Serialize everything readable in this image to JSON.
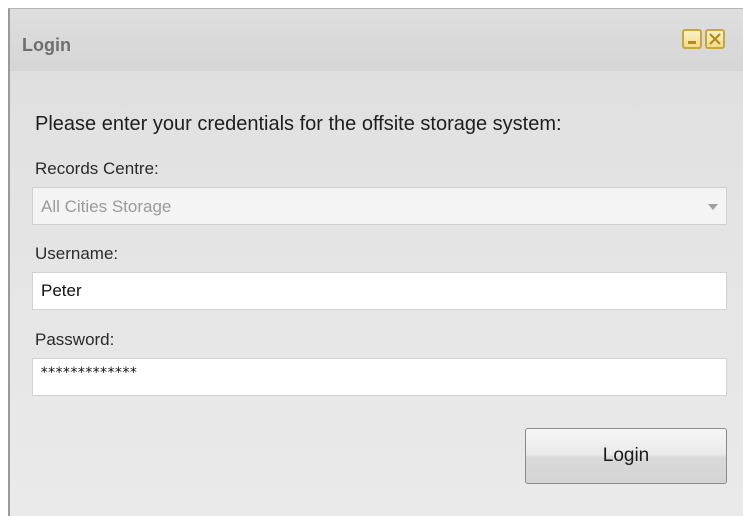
{
  "window": {
    "title": "Login"
  },
  "form": {
    "prompt": "Please enter your credentials for the offsite storage system:",
    "records_centre": {
      "label": "Records Centre:",
      "selected": "All Cities Storage"
    },
    "username": {
      "label": "Username:",
      "value": "Peter"
    },
    "password": {
      "label": "Password:",
      "masked_value": "*************"
    },
    "submit_label": "Login"
  },
  "icons": {
    "minimize": "minimize-icon",
    "close": "close-icon",
    "dropdown": "chevron-down-icon"
  },
  "colors": {
    "window_bg": "#e2e2e2",
    "title_text": "#6e6e6e",
    "caption_button": "#f2dc8c"
  }
}
